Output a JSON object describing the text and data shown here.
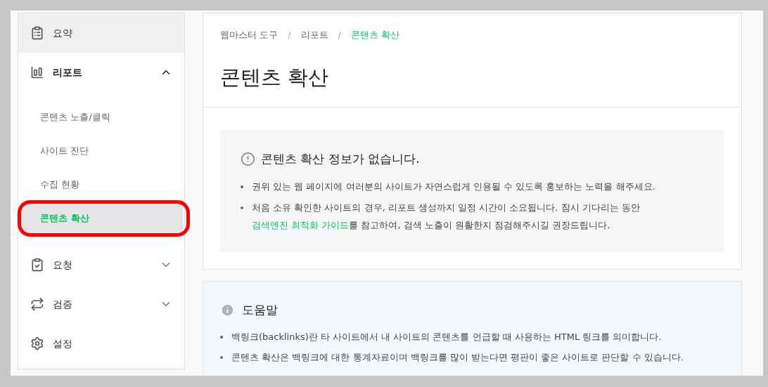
{
  "sidebar": {
    "items": [
      {
        "label": "요약",
        "selected": true
      },
      {
        "label": "리포트",
        "selected": false,
        "expanded": true,
        "children": [
          {
            "label": "콘텐츠 노출/클릭",
            "selected": false
          },
          {
            "label": "사이트 진단",
            "selected": false
          },
          {
            "label": "수집 현황",
            "selected": false
          },
          {
            "label": "콘텐츠 확산",
            "selected": true
          }
        ]
      },
      {
        "label": "요청",
        "selected": false,
        "expanded": false
      },
      {
        "label": "검증",
        "selected": false,
        "expanded": false
      },
      {
        "label": "설정",
        "selected": false
      }
    ]
  },
  "breadcrumb": [
    {
      "label": "웹마스터 도구"
    },
    {
      "label": "리포트"
    },
    {
      "label": "콘텐츠 확산"
    }
  ],
  "breadcrumb_separator": "/",
  "page_title": "콘텐츠 확산",
  "notice": {
    "title": "콘텐츠 확산 정보가 없습니다.",
    "bullets": [
      [
        {
          "kind": "text",
          "text": "권위 있는 웹 페이지에 여러분의 사이트가 자연스럽게 인용될 수 있도록 홍보하는 노력을 해주세요."
        }
      ],
      [
        {
          "kind": "text",
          "text": "처음 소유 확인한 사이트의 경우, 리포트 생성까지 일정 시간이 소요됩니다. 잠시 기다리는 동안 "
        },
        {
          "kind": "link",
          "text": "검색엔진 최적화 가이드"
        },
        {
          "kind": "text",
          "text": "를 참고하여, 검색 노출이 원활한지 점검해주시길 권장드립니다."
        }
      ]
    ]
  },
  "help": {
    "title": "도움말",
    "bullets": [
      "백링크(backlinks)란 타 사이트에서 내 사이트의 콘텐츠를 언급할 때 사용하는 HTML 링크를 의미합니다.",
      "콘텐츠 확산은 백링크에 대한 통계자료이며 백링크를 많이 받는다면 평판이 좋은 사이트로 판단할 수 있습니다."
    ]
  }
}
